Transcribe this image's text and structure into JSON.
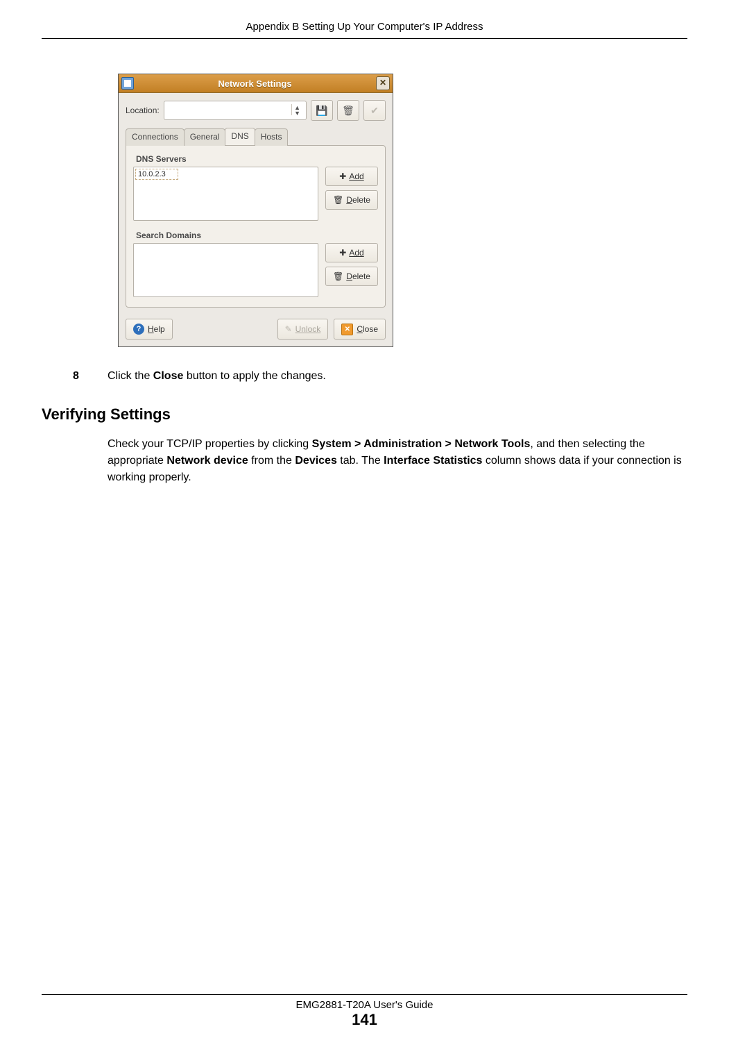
{
  "header": {
    "text": "Appendix B Setting Up Your Computer's IP Address"
  },
  "dialog": {
    "title": "Network Settings",
    "location_label": "Location:",
    "tabs": [
      "Connections",
      "General",
      "DNS",
      "Hosts"
    ],
    "active_tab_index": 2,
    "dns_group_label": "DNS Servers",
    "dns_entry": "10.0.2.3",
    "search_group_label": "Search Domains",
    "add_label": "Add",
    "delete_label": "Delete",
    "help_label": "Help",
    "unlock_label": "Unlock",
    "close_label": "Close"
  },
  "step": {
    "number": "8",
    "pre": "Click the ",
    "bold": "Close",
    "post": " button to apply the changes."
  },
  "section_heading": "Verifying Settings",
  "para": {
    "p1": "Check your TCP/IP properties by clicking ",
    "b1": "System > Administration > Network Tools",
    "p2": ", and then selecting the appropriate ",
    "b2": "Network device",
    "p3": " from the ",
    "b3": "Devices",
    "p4": " tab. The ",
    "b4": "Interface Statistics",
    "p5": " column shows data if your connection is working properly."
  },
  "footer": {
    "guide": "EMG2881-T20A User's Guide",
    "page": "141"
  }
}
